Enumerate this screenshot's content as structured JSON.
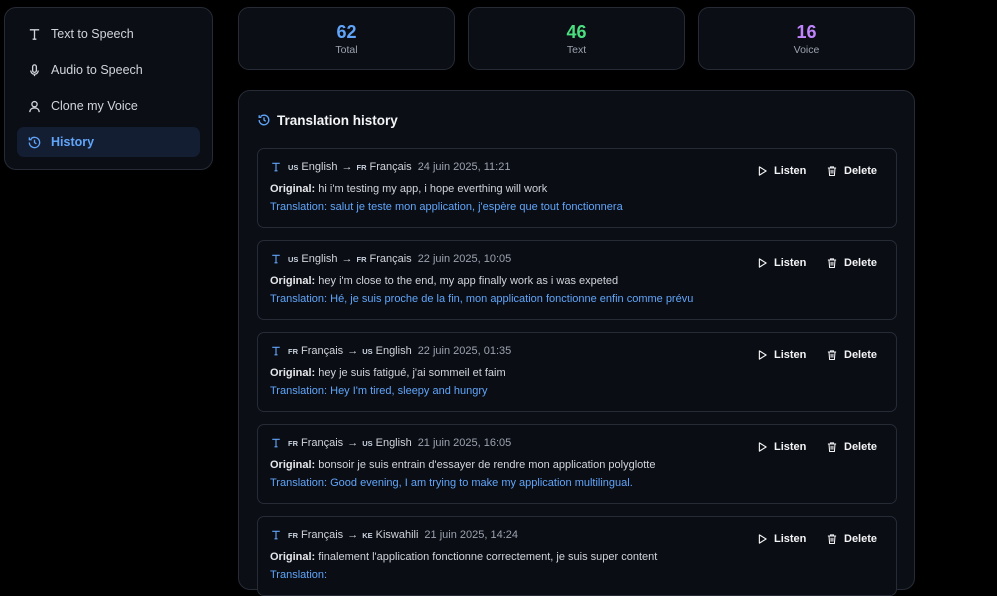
{
  "sidebar": {
    "items": [
      {
        "label": "Text to Speech",
        "icon": "text-icon"
      },
      {
        "label": "Audio to Speech",
        "icon": "microphone-icon"
      },
      {
        "label": "Clone my Voice",
        "icon": "user-icon"
      },
      {
        "label": "History",
        "icon": "history-icon",
        "active": true
      }
    ]
  },
  "stats": [
    {
      "value": "62",
      "label": "Total",
      "color": "#60a5fa"
    },
    {
      "value": "46",
      "label": "Text",
      "color": "#4ade80"
    },
    {
      "value": "16",
      "label": "Voice",
      "color": "#c084fc"
    }
  ],
  "panel": {
    "title": "Translation history",
    "original_label": "Original:",
    "translation_label": "Translation:",
    "listen_label": "Listen",
    "delete_label": "Delete"
  },
  "history": [
    {
      "from_flag": "US",
      "from_lang": "English",
      "to_flag": "FR",
      "to_lang": "Français",
      "date": "24 juin 2025, 11:21",
      "original": "hi i'm testing my app, i hope everthing will work",
      "translation": "salut je teste mon application, j'espère que tout fonctionnera"
    },
    {
      "from_flag": "US",
      "from_lang": "English",
      "to_flag": "FR",
      "to_lang": "Français",
      "date": "22 juin 2025, 10:05",
      "original": "hey i'm close to the end, my app finally work as i was expeted",
      "translation": "Hé, je suis proche de la fin, mon application fonctionne enfin comme prévu"
    },
    {
      "from_flag": "FR",
      "from_lang": "Français",
      "to_flag": "US",
      "to_lang": "English",
      "date": "22 juin 2025, 01:35",
      "original": "hey je suis fatigué, j'ai sommeil et faim",
      "translation": "Hey I'm tired, sleepy and hungry"
    },
    {
      "from_flag": "FR",
      "from_lang": "Français",
      "to_flag": "US",
      "to_lang": "English",
      "date": "21 juin 2025, 16:05",
      "original": "bonsoir je suis entrain d'essayer de rendre mon application polyglotte",
      "translation": "Good evening, I am trying to make my application multilingual."
    },
    {
      "from_flag": "FR",
      "from_lang": "Français",
      "to_flag": "KE",
      "to_lang": "Kiswahili",
      "date": "21 juin 2025, 14:24",
      "original": "finalement l'application fonctionne correctement, je suis super content",
      "translation": ""
    }
  ]
}
